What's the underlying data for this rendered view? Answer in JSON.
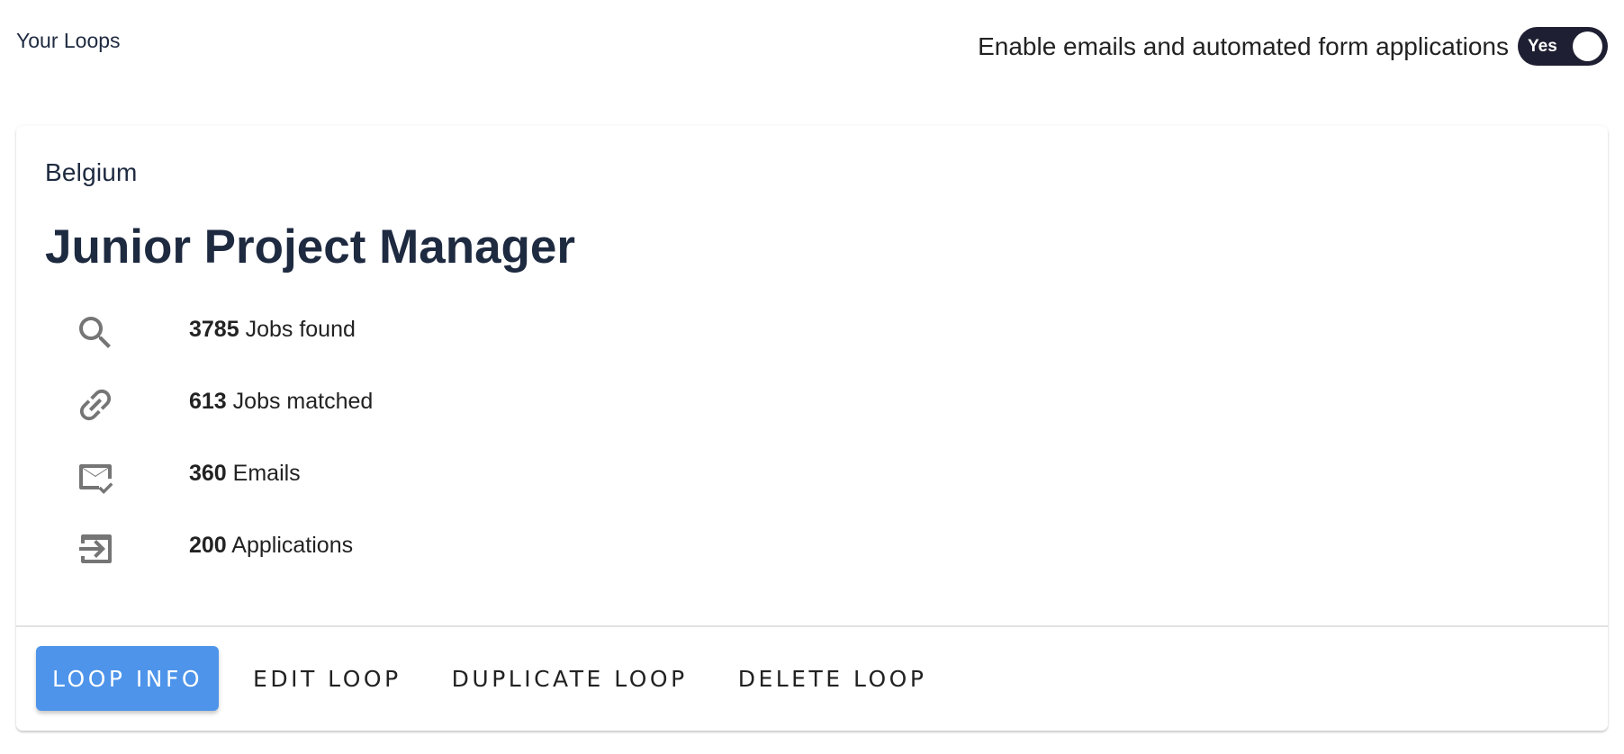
{
  "header": {
    "section_title": "Your Loops",
    "toggle": {
      "label": "Enable emails and automated form applications",
      "state_text": "Yes",
      "enabled": true,
      "track_color": "#1f1f33"
    }
  },
  "loop": {
    "country": "Belgium",
    "title": "Junior Project Manager",
    "stats": [
      {
        "icon": "search-icon",
        "value": "3785",
        "label": "Jobs found"
      },
      {
        "icon": "link-icon",
        "value": "613",
        "label": "Jobs matched"
      },
      {
        "icon": "mail-check-icon",
        "value": "360",
        "label": "Emails"
      },
      {
        "icon": "exit-to-app-icon",
        "value": "200",
        "label": "Applications"
      }
    ],
    "actions": {
      "loop_info": "Loop Info",
      "edit": "Edit Loop",
      "duplicate": "Duplicate Loop",
      "delete": "Delete Loop"
    }
  },
  "colors": {
    "primary": "#4d94ea",
    "text_dark": "#1e2a40",
    "icon_gray": "#757575"
  }
}
